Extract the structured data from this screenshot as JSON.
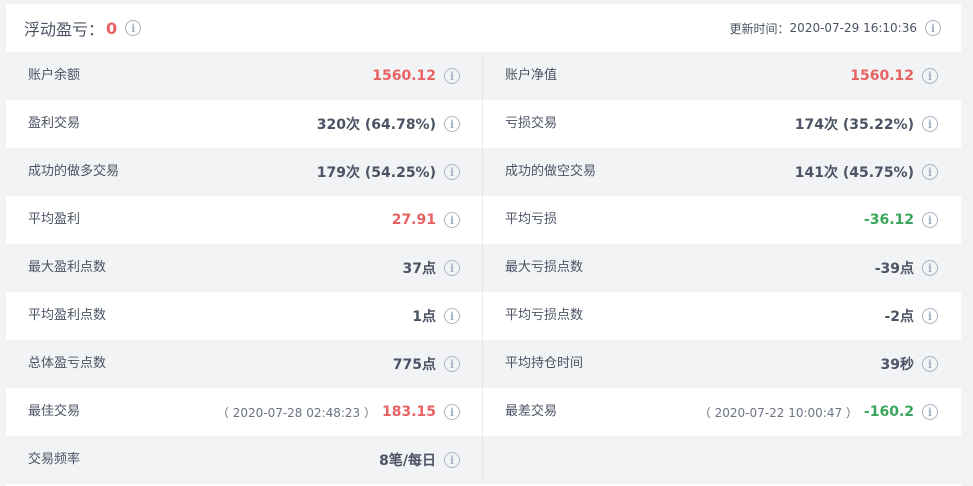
{
  "header": {
    "title": "浮动盈亏：",
    "float_value": "0",
    "update_label": "更新时间：",
    "update_time": "2020-07-29 16:10:36"
  },
  "colors": {
    "profit_red": "#e96263",
    "loss_green": "#3aa65a",
    "icon_gray": "#a8b3c2"
  },
  "rows": [
    {
      "left": {
        "label": "账户余额",
        "value": "1560.12",
        "note": ""
      },
      "right": {
        "label": "账户净值",
        "value": "1560.12",
        "note": ""
      }
    },
    {
      "left": {
        "label": "盈利交易",
        "value": "320次 (64.78%)",
        "note": ""
      },
      "right": {
        "label": "亏损交易",
        "value": "174次 (35.22%)",
        "note": ""
      }
    },
    {
      "left": {
        "label": "成功的做多交易",
        "value": "179次 (54.25%)",
        "note": ""
      },
      "right": {
        "label": "成功的做空交易",
        "value": "141次 (45.75%)",
        "note": ""
      }
    },
    {
      "left": {
        "label": "平均盈利",
        "value": "27.91",
        "note": ""
      },
      "right": {
        "label": "平均亏损",
        "value": "-36.12",
        "note": ""
      }
    },
    {
      "left": {
        "label": "最大盈利点数",
        "value": "37点",
        "note": ""
      },
      "right": {
        "label": "最大亏损点数",
        "value": "-39点",
        "note": ""
      }
    },
    {
      "left": {
        "label": "平均盈利点数",
        "value": "1点",
        "note": ""
      },
      "right": {
        "label": "平均亏损点数",
        "value": "-2点",
        "note": ""
      }
    },
    {
      "left": {
        "label": "总体盈亏点数",
        "value": "775点",
        "note": ""
      },
      "right": {
        "label": "平均持仓时间",
        "value": "39秒",
        "note": ""
      }
    },
    {
      "left": {
        "label": "最佳交易",
        "value": "183.15",
        "note": "（ 2020-07-28 02:48:23 ）"
      },
      "right": {
        "label": "最差交易",
        "value": "-160.2",
        "note": "（ 2020-07-22 10:00:47 ）"
      }
    },
    {
      "left": {
        "label": "交易频率",
        "value": "8笔/每日",
        "note": ""
      }
    }
  ],
  "info_glyph": "i"
}
